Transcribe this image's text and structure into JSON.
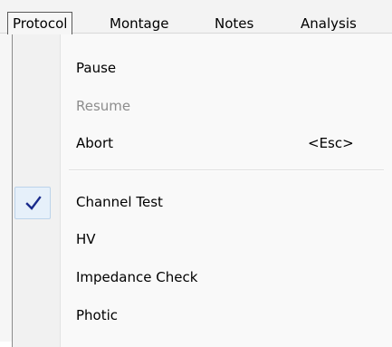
{
  "menubar": {
    "items": [
      {
        "label": "Protocol",
        "active": true
      },
      {
        "label": "Montage"
      },
      {
        "label": "Notes"
      },
      {
        "label": "Analysis"
      }
    ]
  },
  "dropdown": {
    "items": [
      {
        "label": "Pause"
      },
      {
        "label": "Resume",
        "disabled": true
      },
      {
        "label": "Abort",
        "shortcut": "<Esc>"
      },
      {
        "label": "Channel Test",
        "checked": true
      },
      {
        "label": "HV"
      },
      {
        "label": "Impedance Check"
      },
      {
        "label": "Photic"
      }
    ]
  },
  "colors": {
    "check_mark": "#1a2b8c",
    "check_highlight": "#e6f0fa",
    "disabled_text": "#8d8d8d"
  },
  "icons": {
    "checkmark": "checkmark-icon"
  }
}
